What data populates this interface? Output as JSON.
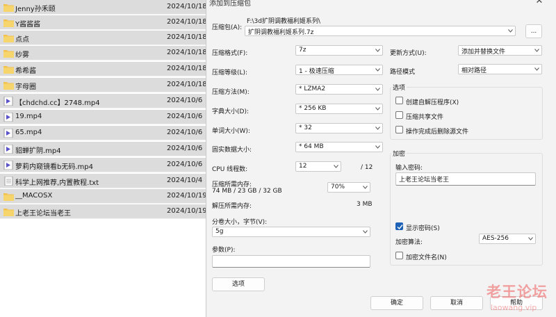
{
  "files": [
    {
      "name": "Jenny孙禾颐",
      "date": "2024/10/18",
      "type": "folder"
    },
    {
      "name": "Y酱酱酱",
      "date": "2024/10/18",
      "type": "folder"
    },
    {
      "name": "点点",
      "date": "2024/10/18",
      "type": "folder"
    },
    {
      "name": "纱雾",
      "date": "2024/10/18",
      "type": "folder"
    },
    {
      "name": "希希酱",
      "date": "2024/10/18",
      "type": "folder"
    },
    {
      "name": "字母圈",
      "date": "2024/10/18",
      "type": "folder"
    },
    {
      "name": "【chdchd.cc】2748.mp4",
      "date": "2024/10/6",
      "type": "video"
    },
    {
      "name": "19.mp4",
      "date": "2024/10/6",
      "type": "video"
    },
    {
      "name": "65.mp4",
      "date": "2024/10/6",
      "type": "video"
    },
    {
      "name": "貂蝉扩阴.mp4",
      "date": "2024/10/6",
      "type": "video"
    },
    {
      "name": "萝莉内窥镜看b无码.mp4",
      "date": "2024/10/6",
      "type": "video"
    },
    {
      "name": "科学上网推荐,内置教程.txt",
      "date": "2024/10/4",
      "type": "text"
    },
    {
      "name": "__MACOSX",
      "date": "2024/10/19",
      "type": "folder"
    },
    {
      "name": "上老王论坛当老王",
      "date": "2024/10/19",
      "type": "folder"
    }
  ],
  "dialog": {
    "title": "添加到压缩包",
    "archive_label": "压缩包(A):",
    "archive_path": "F:\\3d扩阴调教福利姬系列\\",
    "archive_name": "扩阴调教福利姬系列.7z",
    "browse_label": "...",
    "format_label": "压缩格式(F):",
    "format_value": "7z",
    "level_label": "压缩等级(L):",
    "level_value": "1 - 极速压缩",
    "method_label": "压缩方法(M):",
    "method_value": "* LZMA2",
    "dict_label": "字典大小(D):",
    "dict_value": "* 256 KB",
    "word_label": "单词大小(W):",
    "word_value": "* 32",
    "solid_label": "固实数据大小:",
    "solid_value": "* 64 MB",
    "threads_label": "CPU 线程数:",
    "threads_value": "12",
    "threads_total": "/ 12",
    "mem_label": "压缩所需内存:",
    "mem_detail": "74 MB / 23 GB / 32 GB",
    "mem_percent": "70%",
    "decomp_mem_label": "解压所需内存:",
    "decomp_mem_value": "3 MB",
    "split_label": "分卷大小，字节(V):",
    "split_value": "5g",
    "params_label": "参数(P):",
    "params_value": "",
    "options_button": "选项",
    "update_label": "更新方式(U):",
    "update_value": "添加并替换文件",
    "pathmode_label": "路径模式",
    "pathmode_value": "相对路径",
    "options_group": "选项",
    "opt_sfx": "创建自解压程序(X)",
    "opt_shared": "压缩共享文件",
    "opt_delete": "操作完成后删除源文件",
    "enc_group": "加密",
    "enc_password_label": "输入密码:",
    "enc_password_value": "上老王论坛当老王",
    "show_password": "显示密码(S)",
    "enc_method_label": "加密算法:",
    "enc_method_value": "AES-256",
    "enc_filenames": "加密文件名(N)",
    "ok_button": "确定",
    "cancel_button": "取消",
    "help_button": "帮助"
  },
  "watermark": {
    "site": "老王论坛",
    "url": "laowang.vip"
  },
  "colors": {
    "checkbox_accent": "#1e62b8",
    "folder": "#f2c14e",
    "video": "#5b54c9",
    "watermark": "#f06a6a"
  }
}
